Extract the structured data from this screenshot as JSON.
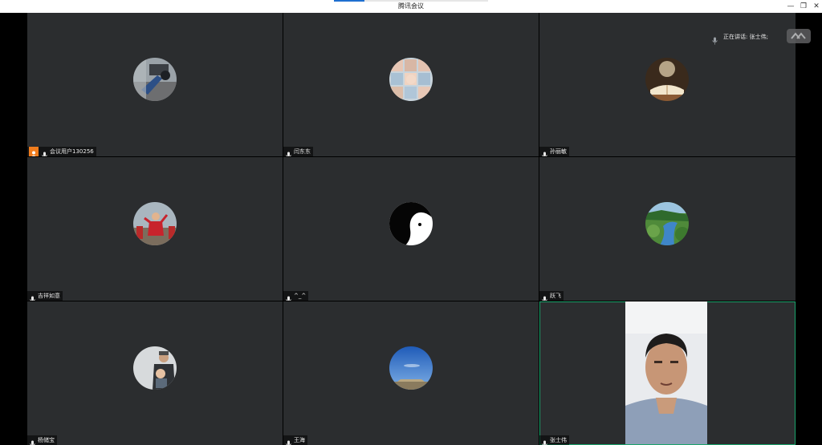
{
  "window": {
    "title": "腾讯会议",
    "controls": {
      "minimize": "—",
      "maximize": "❐",
      "close": "✕"
    }
  },
  "speaking": {
    "text": "正在讲话: 张士伟;"
  },
  "participants": [
    {
      "name": "会议用户130256",
      "host": true,
      "avatar": "street-photo"
    },
    {
      "name": "闫东东",
      "host": false,
      "avatar": "kids-collage"
    },
    {
      "name": "孙丽敏",
      "host": false,
      "avatar": "book-dandelion"
    },
    {
      "name": "吉祥如意",
      "host": false,
      "avatar": "festival-dancer"
    },
    {
      "name": "^_^",
      "host": false,
      "avatar": "anime-silhouette"
    },
    {
      "name": "跃飞",
      "host": false,
      "avatar": "river-valley"
    },
    {
      "name": "杨储宝",
      "host": false,
      "avatar": "man-with-baby"
    },
    {
      "name": "王海",
      "host": false,
      "avatar": "blue-sky"
    },
    {
      "name": "张士伟",
      "host": false,
      "avatar": "live-video",
      "active": true
    }
  ],
  "colors": {
    "tile_bg": "#2b2d2f",
    "active_border": "#1aa36b",
    "host_badge": "#f07c1d",
    "title_accent": "#1f6fd0"
  }
}
